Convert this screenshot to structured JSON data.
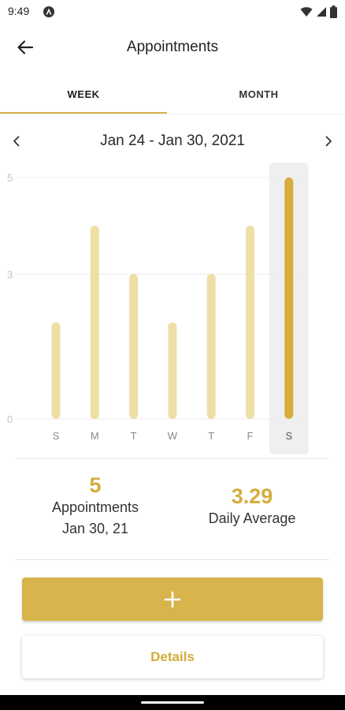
{
  "status_bar": {
    "time": "9:49",
    "icons": [
      "notification-icon",
      "wifi-icon",
      "signal-icon",
      "battery-icon"
    ]
  },
  "app_bar": {
    "title": "Appointments",
    "back_icon": "arrow-back-icon"
  },
  "tabs": [
    {
      "label": "WEEK",
      "selected": true
    },
    {
      "label": "MONTH",
      "selected": false
    }
  ],
  "date_range": {
    "label": "Jan 24 - Jan 30, 2021",
    "prev_icon": "chevron-left-icon",
    "next_icon": "chevron-right-icon"
  },
  "chart_data": {
    "type": "bar",
    "categories": [
      "S",
      "M",
      "T",
      "W",
      "T",
      "F",
      "S"
    ],
    "values": [
      2,
      4,
      3,
      2,
      3,
      4,
      5
    ],
    "y_ticks": [
      "0",
      "3",
      "5"
    ],
    "ylim": [
      0,
      5
    ],
    "selected_index": 6,
    "grid": true,
    "colors": {
      "bar": "#eedfa6",
      "bar_selected": "#d6ad3a",
      "highlight_bg": "#efefef"
    }
  },
  "summary": {
    "selected_count": "5",
    "selected_label": "Appointments",
    "selected_date": "Jan 30, 21",
    "daily_average": "3.29",
    "daily_average_label": "Daily Average"
  },
  "actions": {
    "add_icon": "plus-icon",
    "details_label": "Details"
  },
  "colors": {
    "accent": "#d6b24a"
  }
}
